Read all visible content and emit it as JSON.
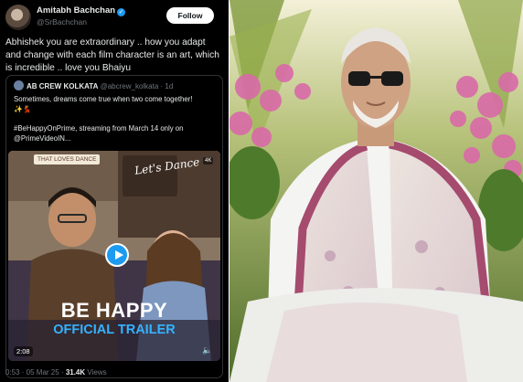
{
  "tweet": {
    "author_name": "Amitabh Bachchan",
    "author_handle": "@SrBachchan",
    "follow_label": "Follow",
    "text": "Abhishek you are extraordinary .. how you adapt and change with each film character is an art, which is incredible .. love you Bhaiyu",
    "quote": {
      "name": "AB CREW KOLKATA",
      "meta": "@abcrew_kolkata · 1d",
      "line1": "Sometimes, dreams come true when two come together!",
      "line2": "✨💃",
      "line3": "#BeHappyOnPrime, streaming from March 14 only on",
      "line4": "@PrimeVideoIN..."
    },
    "video": {
      "title": "BE HAPPY",
      "subtitle": "OFFICIAL TRAILER",
      "duration": "2:08",
      "sign_text": "THAT LOVES DANCE",
      "poster_text": "Let's Dance",
      "corner_tag": "4K"
    },
    "footer": {
      "time_date": "0:53 · 05 Mar 25 · ",
      "views_count": "31.4K",
      "views_label": " Views"
    }
  },
  "icons": {
    "verified": "verified-badge-icon",
    "play": "play-icon",
    "mute": "speaker-icon"
  },
  "colors": {
    "tweet_bg": "#000000",
    "accent_blue": "#1d9bf0",
    "trailer_blue": "#34b3ff"
  }
}
